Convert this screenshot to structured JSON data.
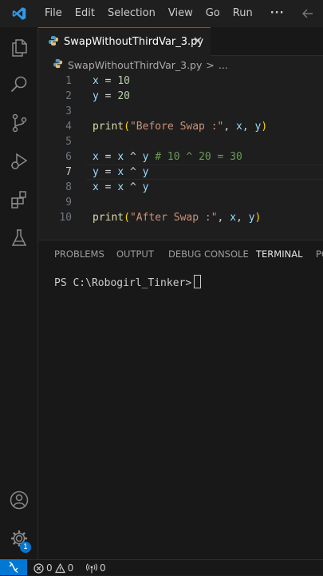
{
  "menu": {
    "file": "File",
    "edit": "Edit",
    "selection": "Selection",
    "view": "View",
    "go": "Go",
    "run": "Run",
    "more": "···"
  },
  "tab": {
    "filename": "SwapWithoutThirdVar_3.py"
  },
  "breadcrumb": {
    "file": "SwapWithoutThirdVar_3.py",
    "sep": ">",
    "more": "..."
  },
  "code": {
    "current_line": 7,
    "lines": [
      {
        "n": "1",
        "segments": [
          {
            "t": "x",
            "c": "var"
          },
          {
            "t": " = ",
            "c": "op"
          },
          {
            "t": "10",
            "c": "num"
          }
        ]
      },
      {
        "n": "2",
        "segments": [
          {
            "t": "y",
            "c": "var"
          },
          {
            "t": " = ",
            "c": "op"
          },
          {
            "t": "20",
            "c": "num"
          }
        ]
      },
      {
        "n": "3",
        "segments": []
      },
      {
        "n": "4",
        "segments": [
          {
            "t": "print",
            "c": "fn"
          },
          {
            "t": "(",
            "c": "paren"
          },
          {
            "t": "\"Before Swap :\"",
            "c": "str"
          },
          {
            "t": ", ",
            "c": "op"
          },
          {
            "t": "x",
            "c": "var"
          },
          {
            "t": ", ",
            "c": "op"
          },
          {
            "t": "y",
            "c": "var"
          },
          {
            "t": ")",
            "c": "paren"
          }
        ]
      },
      {
        "n": "5",
        "segments": []
      },
      {
        "n": "6",
        "segments": [
          {
            "t": "x",
            "c": "var"
          },
          {
            "t": " = ",
            "c": "op"
          },
          {
            "t": "x",
            "c": "var"
          },
          {
            "t": " ^ ",
            "c": "op"
          },
          {
            "t": "y",
            "c": "var"
          },
          {
            "t": " # 10 ^ 20 = 30",
            "c": "comment"
          }
        ]
      },
      {
        "n": "7",
        "segments": [
          {
            "t": "y",
            "c": "var"
          },
          {
            "t": " = ",
            "c": "op"
          },
          {
            "t": "x",
            "c": "var"
          },
          {
            "t": " ^ ",
            "c": "op"
          },
          {
            "t": "y",
            "c": "var"
          }
        ]
      },
      {
        "n": "8",
        "segments": [
          {
            "t": "x",
            "c": "var"
          },
          {
            "t": " = ",
            "c": "op"
          },
          {
            "t": "x",
            "c": "var"
          },
          {
            "t": " ^ ",
            "c": "op"
          },
          {
            "t": "y",
            "c": "var"
          }
        ]
      },
      {
        "n": "9",
        "segments": []
      },
      {
        "n": "10",
        "segments": [
          {
            "t": "print",
            "c": "fn"
          },
          {
            "t": "(",
            "c": "paren"
          },
          {
            "t": "\"After Swap :\"",
            "c": "str"
          },
          {
            "t": ", ",
            "c": "op"
          },
          {
            "t": "x",
            "c": "var"
          },
          {
            "t": ", ",
            "c": "op"
          },
          {
            "t": "y",
            "c": "var"
          },
          {
            "t": ")",
            "c": "paren"
          }
        ]
      }
    ]
  },
  "syntax_colors": {
    "var": "#9cdcfe",
    "op": "#d4d4d4",
    "num": "#b5cea8",
    "fn": "#dcdcaa",
    "paren": "#ffd700",
    "str": "#ce9178",
    "comment": "#6a9955"
  },
  "panel": {
    "tabs": [
      "PROBLEMS",
      "OUTPUT",
      "DEBUG CONSOLE",
      "TERMINAL",
      "PORTS"
    ],
    "active_tab": "TERMINAL",
    "prompt": "PS C:\\Robogirl_Tinker>"
  },
  "status": {
    "errors": "0",
    "warnings": "0",
    "ports": "0"
  },
  "accounts_badge": "1",
  "colors": {
    "accent": "#0078d4",
    "background": "#1e1e1e"
  },
  "icons": {
    "logo": "vscode-logo-icon",
    "explorer": "files-icon",
    "search": "search-icon",
    "scm": "source-control-icon",
    "debug": "run-debug-icon",
    "extensions": "extensions-icon",
    "testing": "flask-icon",
    "accounts": "account-icon",
    "manage": "gear-icon"
  }
}
